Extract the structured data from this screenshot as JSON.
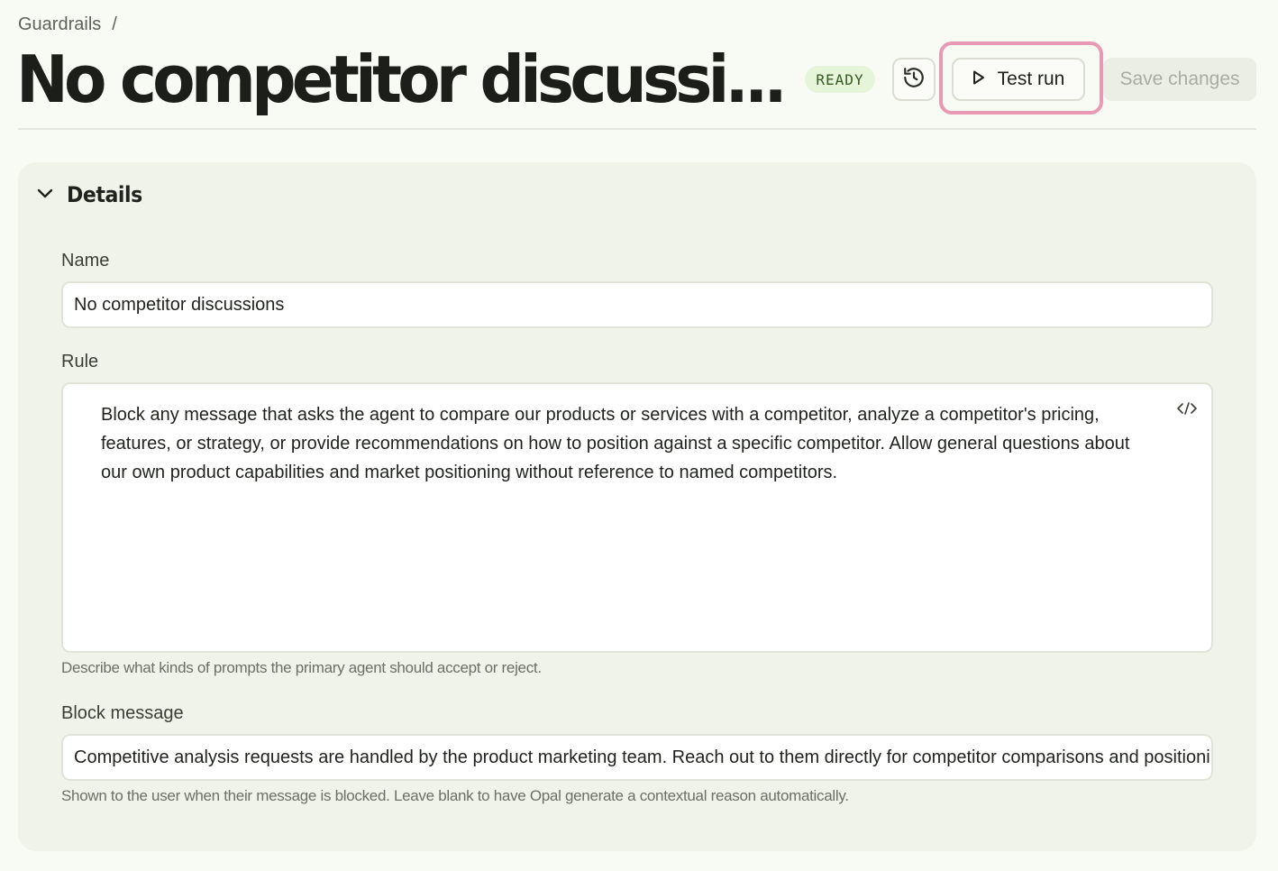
{
  "breadcrumb": {
    "parent": "Guardrails",
    "separator": "/"
  },
  "page": {
    "title": "No competitor discussi..."
  },
  "status": {
    "label": "READY",
    "color": "#e6f4d9"
  },
  "toolbar": {
    "history_icon": "history-icon",
    "test_run_label": "Test run",
    "test_run_icon": "play-icon",
    "save_label": "Save changes",
    "focus_color": "#e89ab5"
  },
  "details": {
    "section_title": "Details",
    "collapse_icon": "chevron-down-icon",
    "name": {
      "label": "Name",
      "value": "No competitor discussions"
    },
    "rule": {
      "label": "Rule",
      "value": "Block any message that asks the agent to compare our products or services with a competitor, analyze a competitor's pricing, features, or strategy, or provide recommendations on how to position against a specific competitor. Allow general questions about our own product capabilities and market positioning without reference to named competitors.",
      "hint": "Describe what kinds of prompts the primary agent should accept or reject.",
      "code_icon": "code-icon"
    },
    "block_message": {
      "label": "Block message",
      "value": "Competitive analysis requests are handled by the product marketing team. Reach out to them directly for competitor comparisons and positioning guidance.",
      "hint": "Shown to the user when their message is blocked. Leave blank to have Opal generate a contextual reason automatically."
    }
  }
}
